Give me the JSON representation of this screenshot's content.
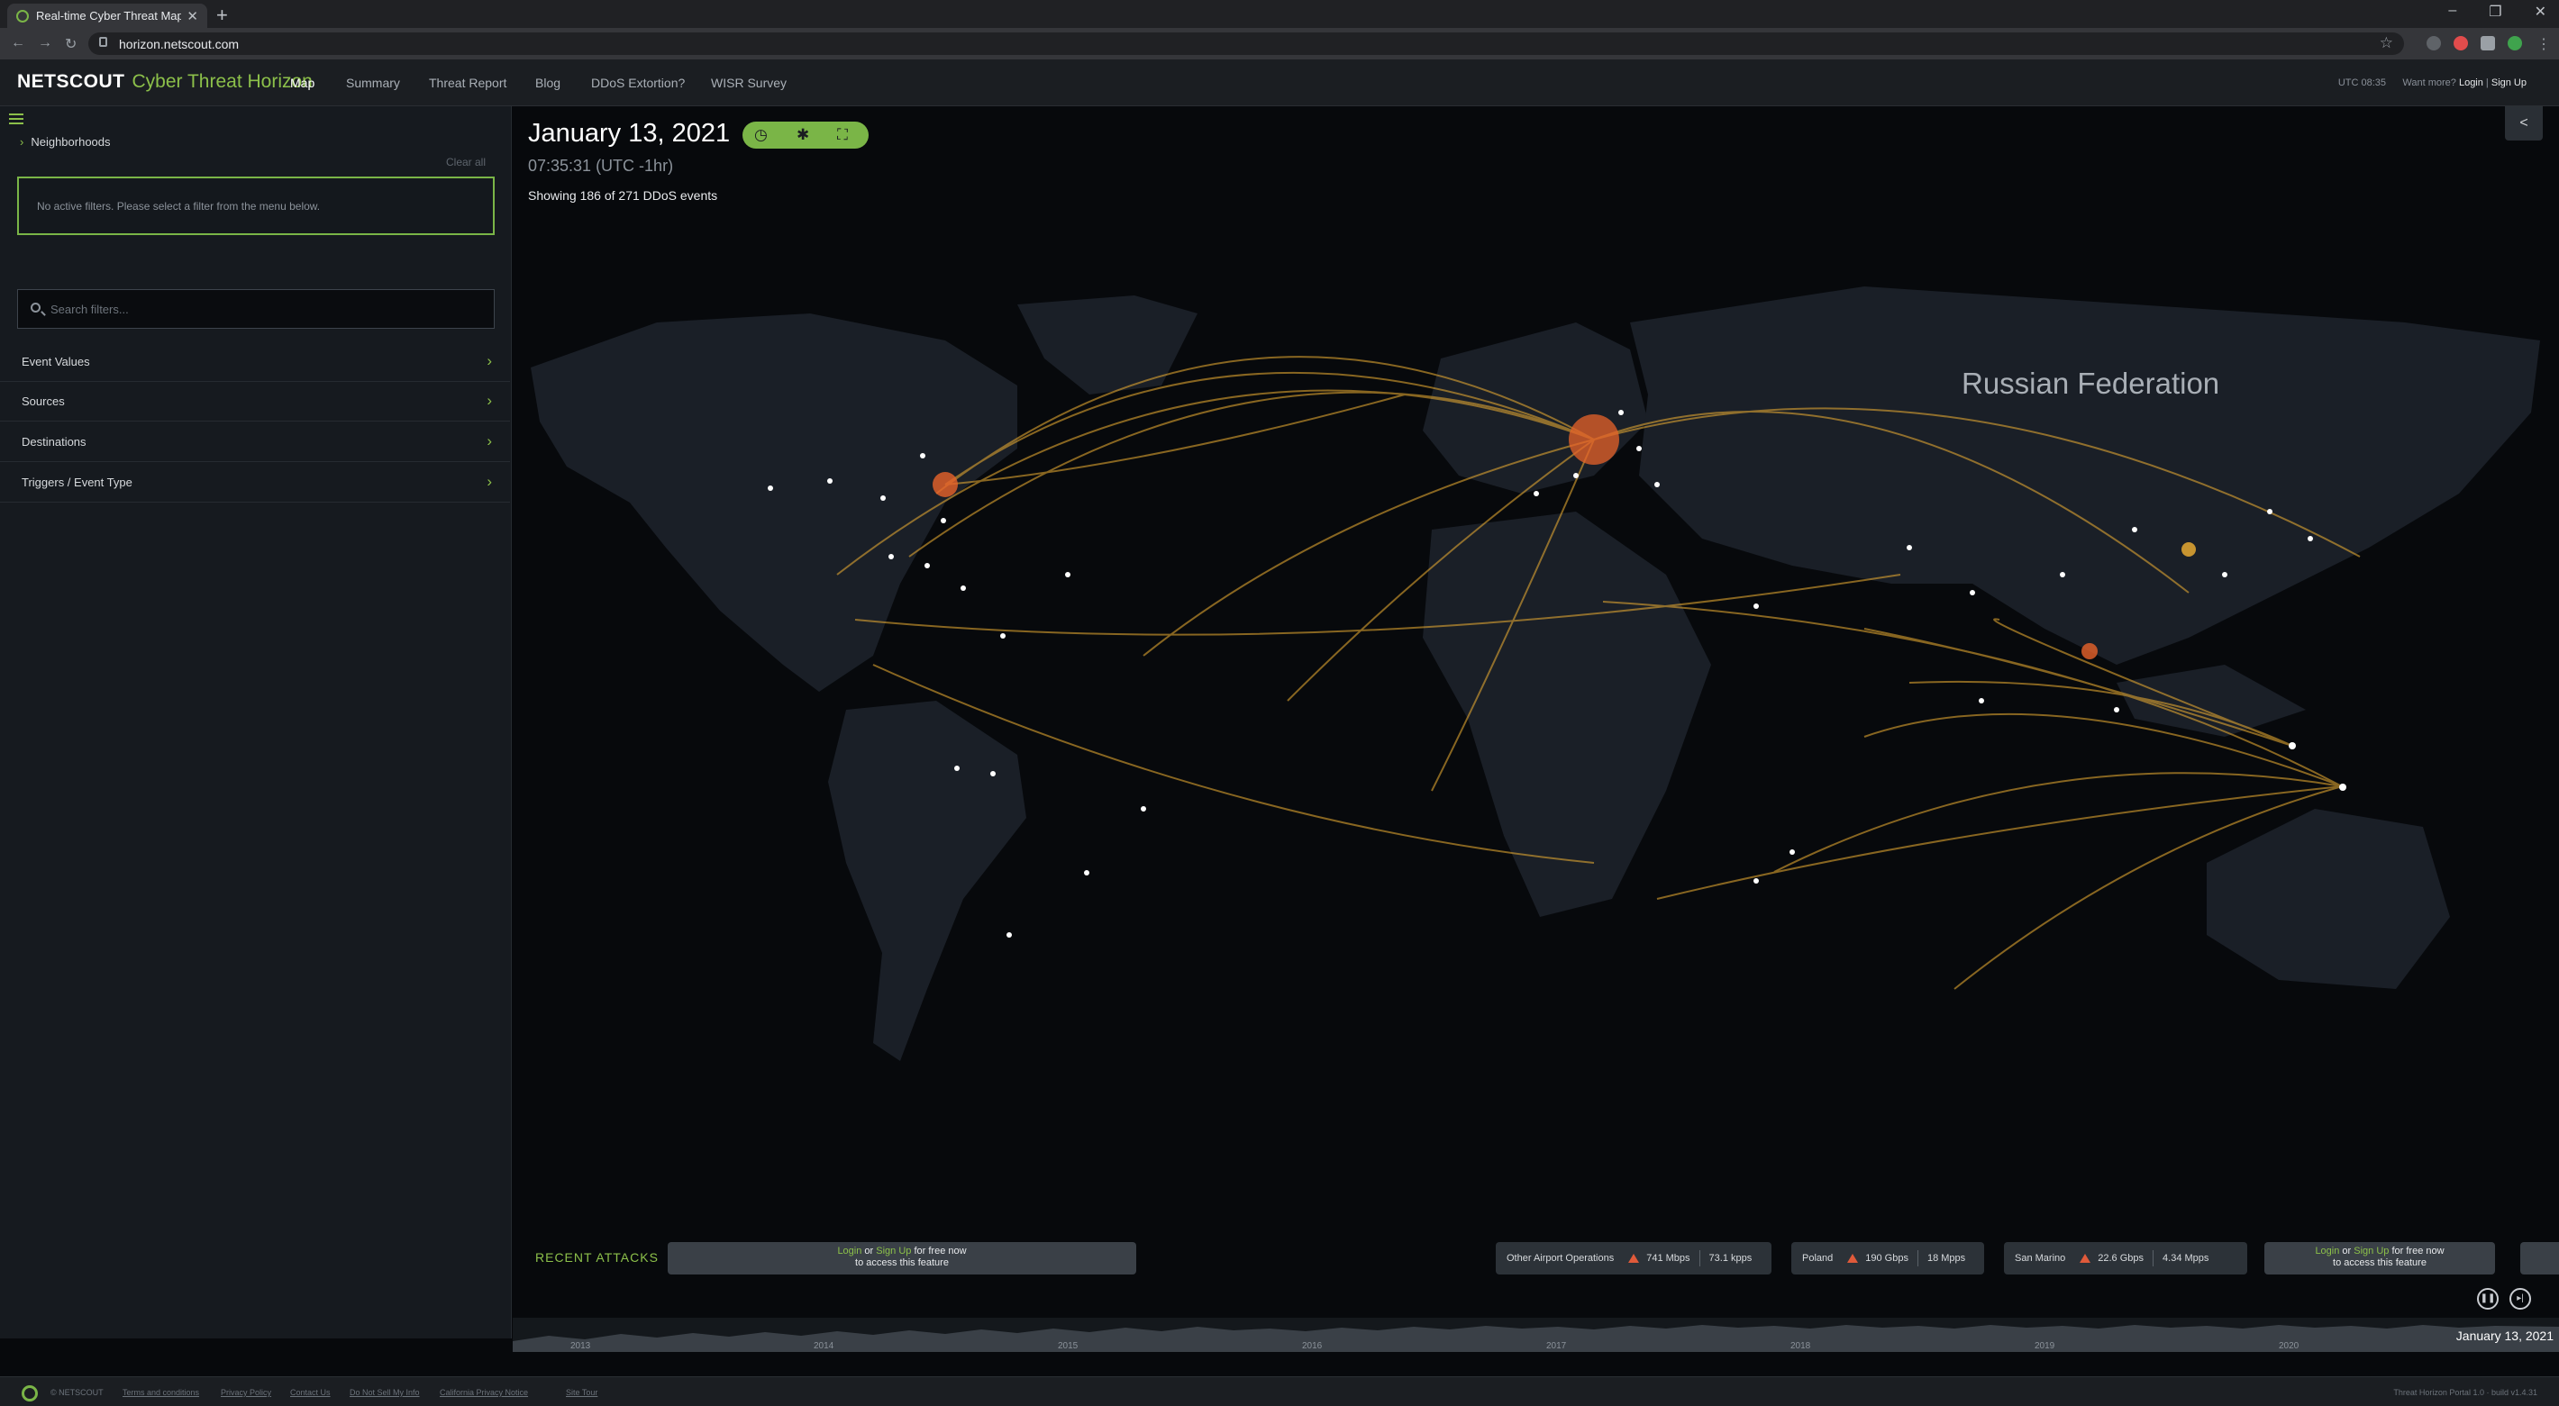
{
  "browser": {
    "tab_title": "Real-time Cyber Threat Map | Ne",
    "url": "horizon.netscout.com"
  },
  "header": {
    "brand_primary": "NETSCOUT",
    "brand_secondary": "Cyber Threat Horizon",
    "nav": [
      "Map",
      "Summary",
      "Threat Report",
      "Blog",
      "DDoS Extortion?",
      "WISR Survey"
    ],
    "utc_time": "UTC 08:35",
    "want_more": "Want more?",
    "login": "Login",
    "signup": "Sign Up"
  },
  "sidebar": {
    "neighborhoods": "Neighborhoods",
    "clear_all": "Clear all",
    "no_filters": "No active filters. Please select a filter from the menu below.",
    "search_placeholder": "Search filters...",
    "facets": [
      "Event Values",
      "Sources",
      "Destinations",
      "Triggers / Event Type"
    ]
  },
  "map": {
    "date": "January 13, 2021",
    "time": "07:35:31 (UTC -1hr)",
    "showing": "Showing 186 of 271 DDoS events",
    "region_label": "Russian Federation"
  },
  "recent_attacks": {
    "label": "RECENT ATTACKS",
    "locked_text_pre": "Login",
    "locked_or": "or",
    "locked_signup": "Sign Up",
    "locked_post": "for free now",
    "locked_line2": "to access this feature",
    "cards": [
      {
        "name": "Other Airport Operations",
        "bw": "741 Mbps",
        "pps": "73.1 kpps"
      },
      {
        "name": "Poland",
        "bw": "190 Gbps",
        "pps": "18 Mpps"
      },
      {
        "name": "San Marino",
        "bw": "22.6 Gbps",
        "pps": "4.34 Mpps"
      }
    ]
  },
  "timeline": {
    "years": [
      "2013",
      "2014",
      "2015",
      "2016",
      "2017",
      "2018",
      "2019",
      "2020"
    ],
    "current_date": "January 13, 2021"
  },
  "footer": {
    "copyright": "© NETSCOUT",
    "links": [
      "Terms and conditions",
      "Privacy Policy",
      "Contact Us",
      "Do Not Sell My Info",
      "California Privacy Notice",
      "Site Tour"
    ],
    "build": "Threat Horizon Portal 1.0 · build v1.4.31"
  },
  "colors": {
    "accent_green": "#8cc04a",
    "arc_gold": "#f2b233",
    "hotspot_orange": "#e8632a"
  }
}
